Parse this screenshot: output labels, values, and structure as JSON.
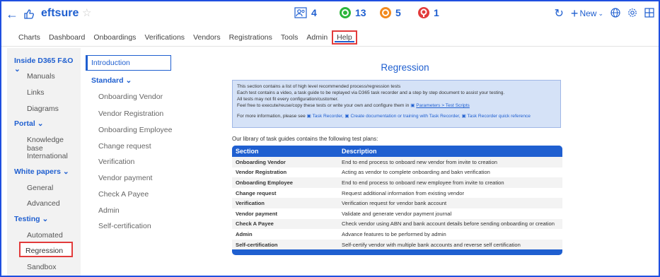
{
  "header": {
    "brand": "eftsure",
    "stats": [
      {
        "name": "users",
        "value": "4",
        "color": "#1f5fd0"
      },
      {
        "name": "green",
        "value": "13",
        "color": "#2cb53b"
      },
      {
        "name": "orange",
        "value": "5",
        "color": "#f28a1e"
      },
      {
        "name": "red",
        "value": "1",
        "color": "#e23b3b"
      }
    ],
    "new_label": "New"
  },
  "menu": {
    "items": [
      "Charts",
      "Dashboard",
      "Onboardings",
      "Verifications",
      "Vendors",
      "Registrations",
      "Tools",
      "Admin",
      "Help"
    ]
  },
  "leftnav": {
    "groups": [
      {
        "label": "Inside D365 F&O",
        "items": [
          "Manuals",
          "Links",
          "Diagrams"
        ]
      },
      {
        "label": "Portal",
        "items": [
          "Knowledge base",
          "International"
        ]
      },
      {
        "label": "White papers",
        "items": [
          "General",
          "Advanced"
        ]
      },
      {
        "label": "Testing",
        "items": [
          "Automated",
          "Regression",
          "Sandbox"
        ]
      }
    ]
  },
  "secnav": {
    "intro": "Introduction",
    "standard": "Standard",
    "items": [
      "Onboarding Vendor",
      "Vendor Registration",
      "Onboarding Employee",
      "Change request",
      "Verification",
      "Vendor payment",
      "Check A Payee",
      "Admin",
      "Self-certification"
    ]
  },
  "main": {
    "title": "Regression",
    "info": {
      "l1": "This section contains a list of high level recommended process/regression tests",
      "l2": "Each test contains a video, a task guide to be replayed via D365 task recorder and a step by step document to assist your testing.",
      "l3": "All tests may not fit every configuration/customer.",
      "l4": "Feel free to execute/reuse/copy these tests or write your own and configure them in",
      "l4_link": "Parameters > Test Scripts",
      "l5": "For more information, please see",
      "link1": "Task Recorder,",
      "link2": "Create documentation or training with Task Recorder,",
      "link3": "Task Recorder quick reference"
    },
    "library_text": "Our library of task guides contains the following test plans:",
    "table": {
      "headers": [
        "Section",
        "Description"
      ],
      "rows": [
        [
          "Onboarding Vendor",
          "End to end process to onboard new vendor from invite to creation"
        ],
        [
          "Vendor Registration",
          "Acting as vendor to complete onboarding and bakn verification"
        ],
        [
          "Onboarding Employee",
          "End to end process to onboard new employee from invite to creation"
        ],
        [
          "Change request",
          "Request additional information from existing vendor"
        ],
        [
          "Verification",
          "Verification request for vendor bank account"
        ],
        [
          "Vendor payment",
          "Validate and generate vendor payment journal"
        ],
        [
          "Check A Payee",
          "Check vendor using ABN and bank account details before sending onboarding or creation"
        ],
        [
          "Admin",
          "Advance features to be performed by admin"
        ],
        [
          "Self-certification",
          "Self-certify vendor with multiple bank accounts and reverse self certification"
        ]
      ]
    }
  }
}
